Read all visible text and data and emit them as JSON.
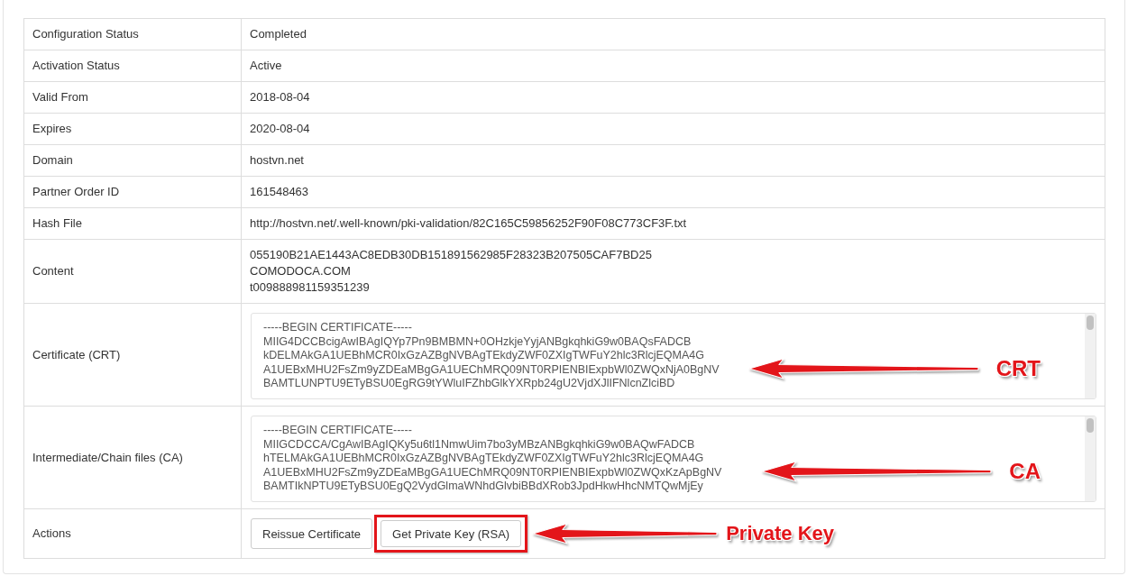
{
  "table": {
    "rows": [
      {
        "kind": "text",
        "label": "Configuration Status",
        "value": "Completed"
      },
      {
        "kind": "text",
        "label": "Activation Status",
        "value": "Active"
      },
      {
        "kind": "text",
        "label": "Valid From",
        "value": "2018-08-04"
      },
      {
        "kind": "text",
        "label": "Expires",
        "value": "2020-08-04"
      },
      {
        "kind": "text",
        "label": "Domain",
        "value": "hostvn.net"
      },
      {
        "kind": "text",
        "label": "Partner Order ID",
        "value": "161548463"
      },
      {
        "kind": "text",
        "label": "Hash File",
        "value": "http://hostvn.net/.well-known/pki-validation/82C165C59856252F90F08C773CF3F.txt"
      },
      {
        "kind": "lines",
        "label": "Content",
        "lines": [
          "055190B21AE1443AC8EDB30DB151891562985F28323B207505CAF7BD25",
          "COMODOCA.COM",
          "t009888981159351239"
        ]
      },
      {
        "kind": "textarea",
        "label": "Certificate (CRT)",
        "lines": [
          "-----BEGIN CERTIFICATE-----",
          "MIIG4DCCBcigAwIBAgIQYp7Pn9BMBMN+0OHzkjeYyjANBgkqhkiG9w0BAQsFADCB",
          "kDELMAkGA1UEBhMCR0IxGzAZBgNVBAgTEkdyZWF0ZXIgTWFuY2hlc3RlcjEQMA4G",
          "A1UEBxMHU2FsZm9yZDEaMBgGA1UEChMRQ09NT0RPIENBIExpbWl0ZWQxNjA0BgNV",
          "BAMTLUNPTU9ETyBSU0EgRG9tYWluIFZhbGlkYXRpb24gU2VjdXJlIFNlcnZlciBD"
        ],
        "annotation": "CRT"
      },
      {
        "kind": "textarea",
        "label": "Intermediate/Chain files (CA)",
        "lines": [
          "-----BEGIN CERTIFICATE-----",
          "MIIGCDCCA/CgAwIBAgIQKy5u6tl1NmwUim7bo3yMBzANBgkqhkiG9w0BAQwFADCB",
          "hTELMAkGA1UEBhMCR0IxGzAZBgNVBAgTEkdyZWF0ZXIgTWFuY2hlc3RlcjEQMA4G",
          "A1UEBxMHU2FsZm9yZDEaMBgGA1UEChMRQ09NT0RPIENBIExpbWl0ZWQxKzApBgNV",
          "BAMTIkNPTU9ETyBSU0EgQ2VydGlmaWNhdGlvbiBBdXRob3JpdHkwHhcNMTQwMjEy"
        ],
        "annotation": "CA"
      },
      {
        "kind": "buttons",
        "label": "Actions",
        "buttons": [
          {
            "label": "Reissue Certificate",
            "highlighted": false
          },
          {
            "label": "Get Private Key (RSA)",
            "highlighted": true
          }
        ],
        "annotation": "Private Key"
      }
    ]
  }
}
